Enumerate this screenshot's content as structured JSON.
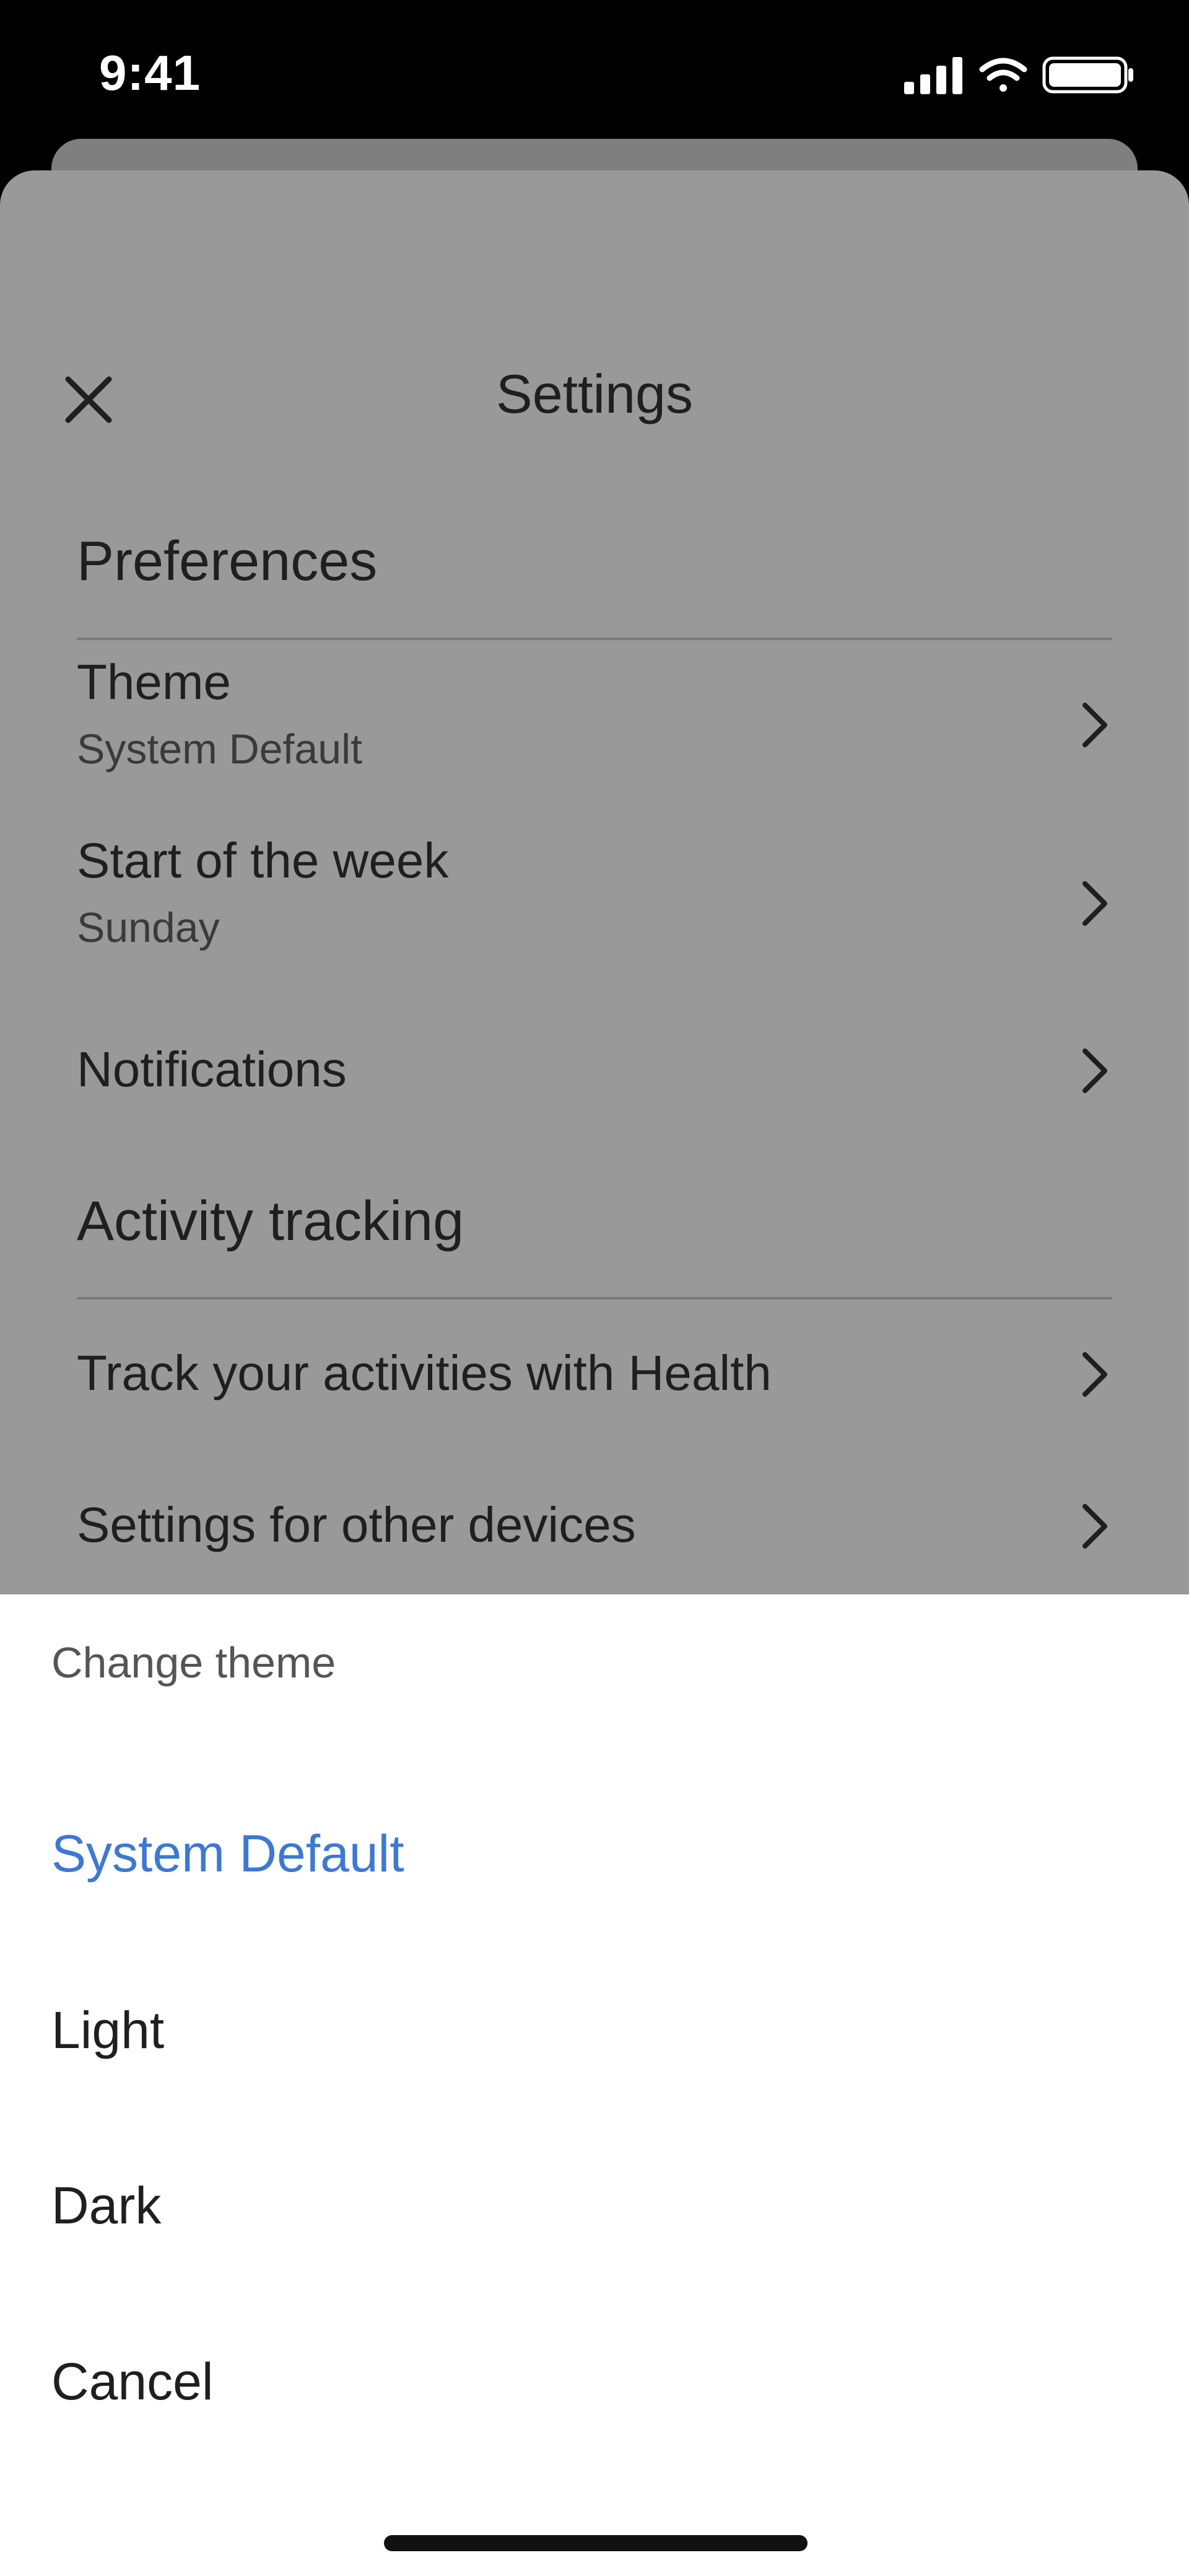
{
  "status_bar": {
    "time": "9:41",
    "icons": [
      "cellular-signal-icon",
      "wifi-icon",
      "battery-icon"
    ]
  },
  "settings": {
    "title": "Settings",
    "close_icon": "close-icon",
    "sections": {
      "preferences": {
        "heading": "Preferences",
        "rows": [
          {
            "title": "Theme",
            "value": "System Default"
          },
          {
            "title": "Start of the week",
            "value": "Sunday"
          },
          {
            "title": "Notifications"
          }
        ]
      },
      "activity": {
        "heading": "Activity tracking",
        "rows": [
          {
            "title": "Track your activities with Health"
          },
          {
            "title": "Settings for other devices"
          }
        ]
      }
    }
  },
  "theme_sheet": {
    "title": "Change theme",
    "options": [
      {
        "label": "System Default",
        "selected": true
      },
      {
        "label": "Light",
        "selected": false
      },
      {
        "label": "Dark",
        "selected": false
      }
    ],
    "cancel": "Cancel"
  },
  "colors": {
    "accent": "#3b78d8",
    "scrim": "#999999",
    "sheet_bg": "#ffffff"
  }
}
